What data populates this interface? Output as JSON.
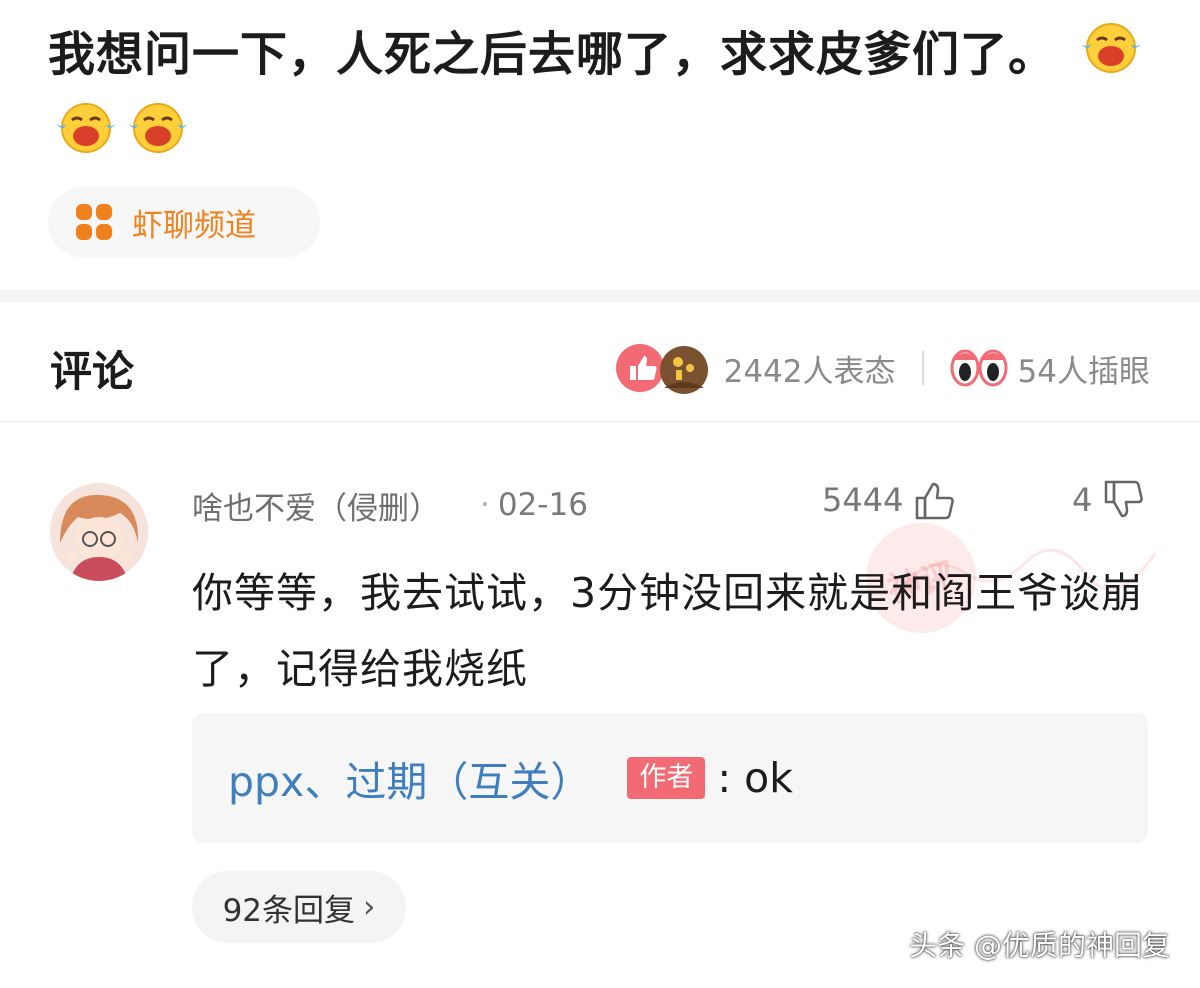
{
  "post": {
    "title": "我想问一下，人死之后去哪了，求求皮爹们了。",
    "emojis": [
      "crying-face-emoji",
      "crying-face-emoji",
      "crying-face-emoji"
    ],
    "channel": {
      "label": "虾聊频道",
      "icon": "four-dots-icon",
      "color": "#f0821e"
    }
  },
  "comments_section": {
    "title": "评论",
    "reactions_text": "2442人表态",
    "views_text": "54人插眼"
  },
  "comment": {
    "username": "啥也不爱（侵删）",
    "date": "02-16",
    "likes": "5444",
    "dislikes": "4",
    "body": "你等等，我去试试，3分钟没回来就是和阎王爷谈崩了，记得给我烧纸",
    "watermark_badge": "神评",
    "reply": {
      "user": "ppx、过期（互关）",
      "badge": "作者",
      "text": ": ok"
    },
    "replies_label": "92条回复",
    "replies_chevron": "›"
  },
  "footer": {
    "watermark": "头条 @优质的神回复"
  },
  "colors": {
    "accent_orange": "#f0821e",
    "link_blue": "#3f7fc0",
    "badge_red": "#f26b74"
  }
}
